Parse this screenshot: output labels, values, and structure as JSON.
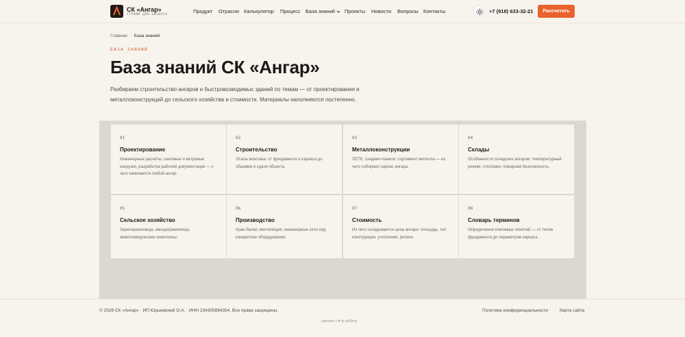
{
  "header": {
    "logo_name": "СК «Ангар»",
    "logo_tagline": "СТРОИМ ДЛЯ БИЗНЕСА",
    "nav": [
      {
        "label": "Продукт"
      },
      {
        "label": "Отрасли"
      },
      {
        "label": "Калькулятор"
      },
      {
        "label": "Процесс"
      },
      {
        "label": "База знаний",
        "has_dropdown": true
      },
      {
        "label": "Проекты"
      },
      {
        "label": "Новости"
      },
      {
        "label": "Вопросы"
      },
      {
        "label": "Контакты"
      }
    ],
    "theme_icon": "sun-icon",
    "phone": "+7 (918) 633-32-21",
    "cta_label": "Рассчитать"
  },
  "breadcrumb": {
    "home": "Главная",
    "separator": "·",
    "current": "База знаний"
  },
  "hero": {
    "eyebrow": "БАЗА ЗНАНИЙ",
    "title": "База знаний СК «Ангар»",
    "lead": "Разбираем строительство ангаров и быстровозводимых зданий по темам — от проектирования и металлоконструкций до сельского хозяйства и стоимости. Материалы наполняются постепенно."
  },
  "cards": [
    {
      "num": "01",
      "title": "Проектирование",
      "desc": "Инженерные расчёты, снеговые и ветровые нагрузки, разработка рабочей документации — с чего начинается любой ангар."
    },
    {
      "num": "02",
      "title": "Строительство",
      "desc": "Этапы монтажа: от фундамента и каркаса до обшивки и сдачи объекта."
    },
    {
      "num": "03",
      "title": "Металлоконструкции",
      "desc": "ЛСТК, сэндвич-панели, сортамент металла — из чего собирают каркас ангара."
    },
    {
      "num": "04",
      "title": "Склады",
      "desc": "Особенности складских ангаров: температурный режим, стеллажи, пожарная безопасность."
    },
    {
      "num": "05",
      "title": "Сельское хозяйство",
      "desc": "Зернохранилища, овощехранилища, животноводческие комплексы."
    },
    {
      "num": "06",
      "title": "Производство",
      "desc": "Кран-балки, вентиляция, инженерные сети под конкретное оборудование."
    },
    {
      "num": "07",
      "title": "Стоимость",
      "desc": "Из чего складывается цена ангара: площадь, тип конструкции, утепление, регион."
    },
    {
      "num": "08",
      "title": "Словарь терминов",
      "desc": "Определения ключевых понятий — от типов фундамента до параметров каркаса."
    }
  ],
  "footer": {
    "copyright": "© 2026 СК «Ангар» · ИП Юршевский О.А. · ИНН 234305894354. Все права защищены.",
    "privacy": "Политика конфиденциальности",
    "sitemap": "Карта сайта",
    "made_prefix": "сделано с",
    "made_suffix": "by gr@ing"
  },
  "colors": {
    "accent": "#e8622b",
    "background": "#f7f4ee",
    "grid_border": "#dcd8d1"
  }
}
